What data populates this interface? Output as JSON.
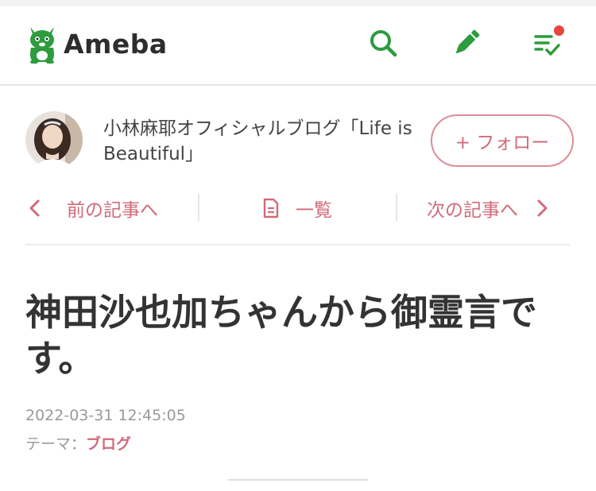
{
  "header": {
    "logo_text": "Ameba",
    "icons": [
      "search-icon",
      "pencil-icon",
      "checklist-icon"
    ],
    "accent_color": "#2e9b3e",
    "badge_color": "#e8453c"
  },
  "blog": {
    "title": "小林麻耶オフィシャルブログ「Life is Beautiful」",
    "follow_label": "+ フォロー"
  },
  "nav": {
    "prev_label": "前の記事へ",
    "list_label": "一覧",
    "next_label": "次の記事へ",
    "accent_color": "#d06b7a"
  },
  "post": {
    "title": "神田沙也加ちゃんから御霊言です。",
    "date": "2022-03-31 12:45:05",
    "theme_prefix": "テーマ：",
    "theme_label": "ブログ"
  }
}
